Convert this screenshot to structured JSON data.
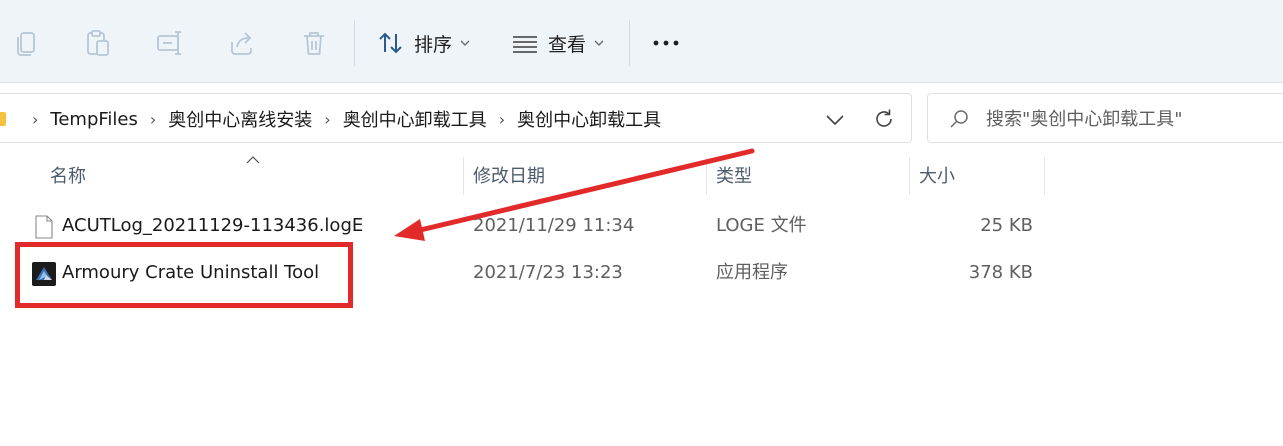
{
  "toolbar": {
    "icons": [
      "copy-icon",
      "paste-icon",
      "rename-icon",
      "share-icon",
      "delete-icon"
    ],
    "sort_label": "排序",
    "view_label": "查看"
  },
  "address": {
    "crumbs": [
      "TempFiles",
      "奥创中心离线安装",
      "奥创中心卸载工具",
      "奥创中心卸载工具"
    ]
  },
  "search": {
    "placeholder": "搜索\"奥创中心卸载工具\""
  },
  "columns": {
    "name": "名称",
    "modified": "修改日期",
    "type": "类型",
    "size": "大小"
  },
  "files": [
    {
      "name": "ACUTLog_20211129-113436.logE",
      "modified": "2021/11/29 11:34",
      "type": "LOGE 文件",
      "size": "25 KB",
      "icon": "text-file-icon"
    },
    {
      "name": "Armoury Crate Uninstall Tool",
      "modified": "2021/7/23 13:23",
      "type": "应用程序",
      "size": "378 KB",
      "icon": "app-icon"
    }
  ],
  "annotation": {
    "color": "#e32a2a"
  }
}
